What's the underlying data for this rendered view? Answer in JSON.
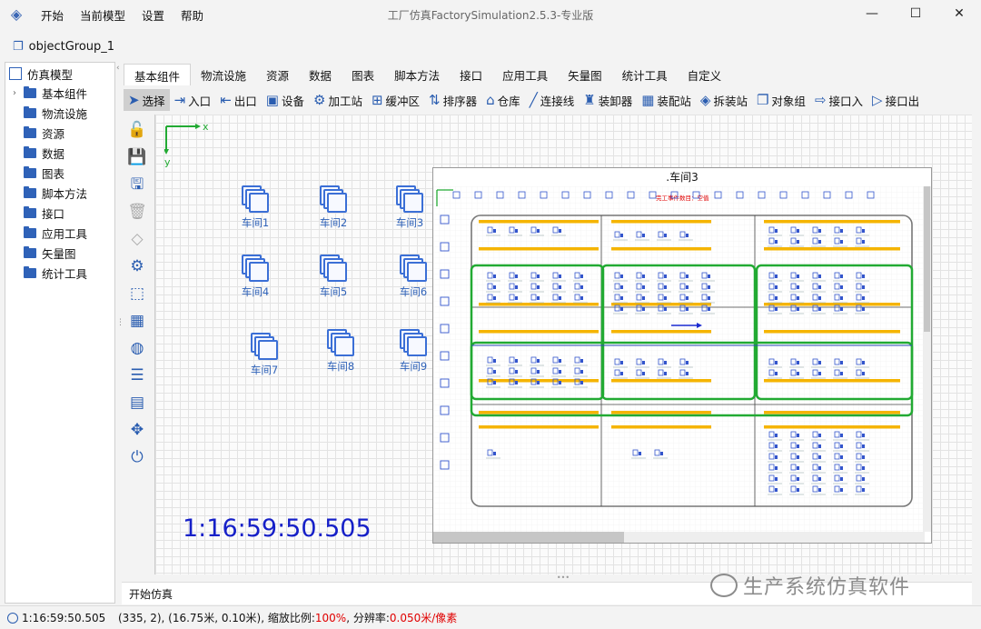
{
  "window": {
    "title": "工厂仿真FactorySimulation2.5.3-专业版",
    "menu": [
      "开始",
      "当前模型",
      "设置",
      "帮助"
    ],
    "controls": [
      "—",
      "☐",
      "✕"
    ]
  },
  "object_group_tab": "objectGroup_1",
  "sidebar": {
    "root": "仿真模型",
    "items": [
      "基本组件",
      "物流设施",
      "资源",
      "数据",
      "图表",
      "脚本方法",
      "接口",
      "应用工具",
      "矢量图",
      "统计工具"
    ]
  },
  "tabs": [
    "基本组件",
    "物流设施",
    "资源",
    "数据",
    "图表",
    "脚本方法",
    "接口",
    "应用工具",
    "矢量图",
    "统计工具",
    "自定义"
  ],
  "toolbar": [
    {
      "label": "选择",
      "icon": "cursor-icon"
    },
    {
      "label": "入口",
      "icon": "entry-icon"
    },
    {
      "label": "出口",
      "icon": "exit-icon"
    },
    {
      "label": "设备",
      "icon": "device-icon"
    },
    {
      "label": "加工站",
      "icon": "workstation-icon"
    },
    {
      "label": "缓冲区",
      "icon": "buffer-icon"
    },
    {
      "label": "排序器",
      "icon": "sorter-icon"
    },
    {
      "label": "仓库",
      "icon": "warehouse-icon"
    },
    {
      "label": "连接线",
      "icon": "connector-icon"
    },
    {
      "label": "装卸器",
      "icon": "loader-icon"
    },
    {
      "label": "装配站",
      "icon": "assembly-icon"
    },
    {
      "label": "拆装站",
      "icon": "disassembly-icon"
    },
    {
      "label": "对象组",
      "icon": "object-group-icon"
    },
    {
      "label": "接口入",
      "icon": "interface-in-icon"
    },
    {
      "label": "接口出",
      "icon": "interface-out-icon"
    }
  ],
  "canvas": {
    "axis_x": "x",
    "axis_y": "y",
    "workshops": [
      "车间1",
      "车间2",
      "车间3",
      "车间4",
      "车间5",
      "车间6",
      "车间7",
      "车间8",
      "车间9"
    ],
    "clock": "1:16:59:50.505",
    "preview": {
      "title": ".车间3",
      "banner": "完工事件数目：空值"
    }
  },
  "console": {
    "text": "开始仿真"
  },
  "watermark": "生产系统仿真软件",
  "status": {
    "time": "1:16:59:50.505",
    "coords": "(335, 2), (16.75米, 0.10米), 缩放比例: ",
    "zoom": "100%",
    "res_label": ", 分辨率: ",
    "resolution": "0.050米/像素"
  },
  "colors": {
    "accent": "#2f62b8",
    "clock": "#1620c8",
    "highlight": "#22aa33",
    "bar": "#f5b400"
  }
}
